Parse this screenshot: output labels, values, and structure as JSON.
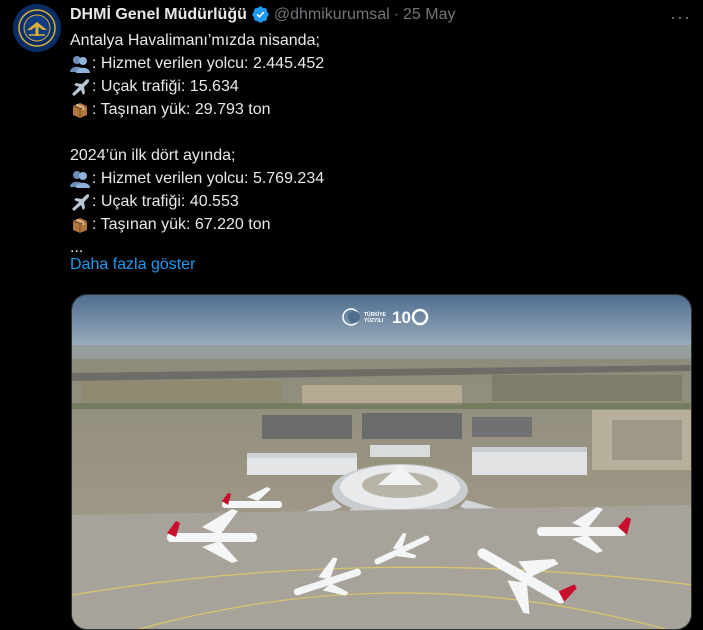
{
  "account": {
    "name": "DHMİ Genel Müdürlüğü",
    "handle": "@dhmikurumsal",
    "separator": "·",
    "date": "25 May",
    "avatar_icon": "dhmi-logo-icon",
    "verified_icon": "verified-badge-icon",
    "verified_color": "#1d9bf0"
  },
  "more_label": "···",
  "tweet": {
    "intro1": "Antalya Havalimanı’mızda nisanda;",
    "apr_passengers": ": Hizmet verilen yolcu: 2.445.452",
    "apr_flights": ": Uçak trafiği: 15.634",
    "apr_cargo": ": Taşınan yük: 29.793 ton",
    "intro2": "2024’ün ilk dört ayında;",
    "ytd_passengers": ": Hizmet verilen yolcu: 5.769.234",
    "ytd_flights": ": Uçak trafiği: 40.553",
    "ytd_cargo": ": Taşınan yük: 67.220 ton",
    "ellipsis": "...",
    "icons": {
      "passengers": "people-silhouette-icon",
      "flights": "airplane-icon",
      "cargo": "package-icon"
    }
  },
  "show_more": "Daha fazla göster",
  "media": {
    "description_icon": "airport-aerial-photo",
    "overlay_brand": "TÜRKİYE YÜZYILI",
    "overlay_100": "100"
  },
  "colors": {
    "background": "#000000",
    "text": "#e7e9ea",
    "muted": "#71767b",
    "link": "#1d9bf0"
  }
}
